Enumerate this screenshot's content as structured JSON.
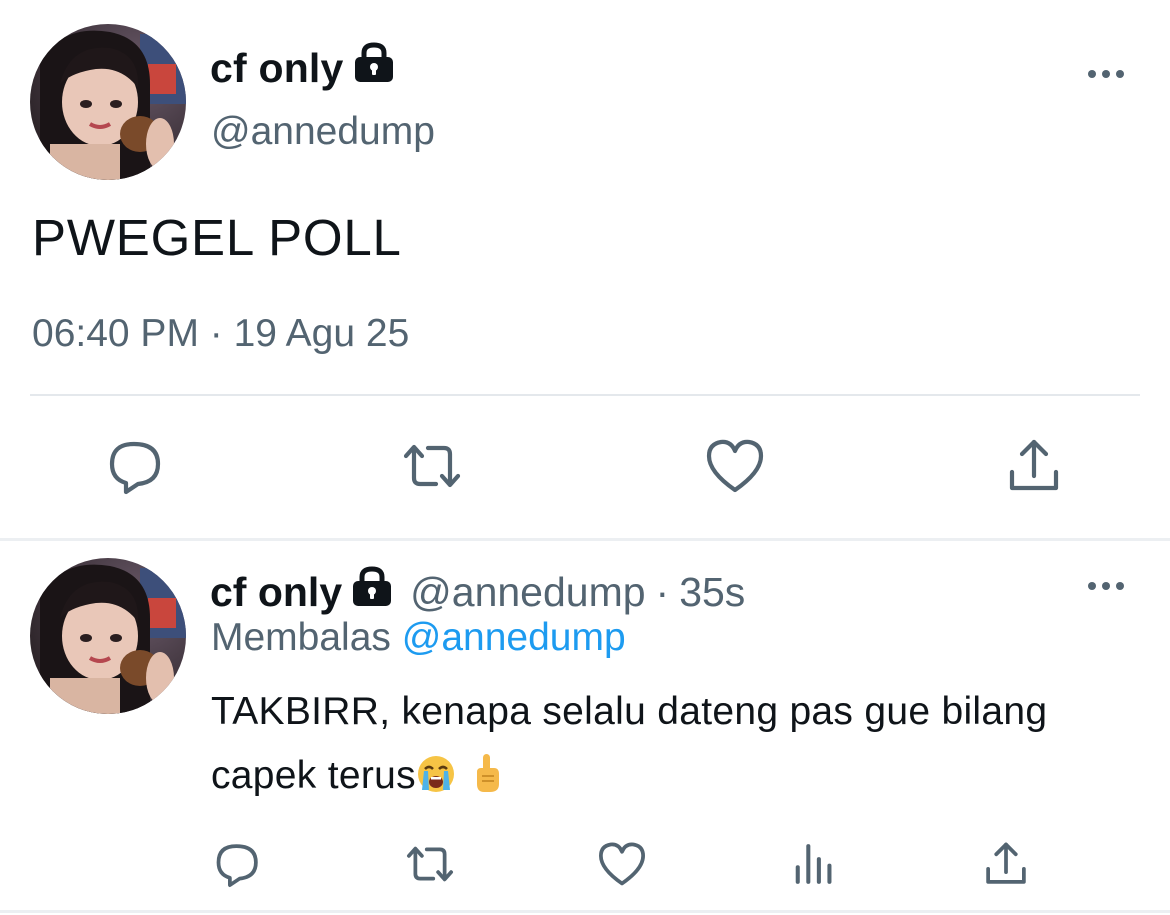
{
  "tweet": {
    "display_name": "cf only",
    "handle": "@annedump",
    "text": "PWEGEL POLL",
    "timestamp": "06:40 PM · 19 Agu 25",
    "actions": [
      "reply",
      "retweet",
      "like",
      "share"
    ]
  },
  "reply": {
    "display_name": "cf only",
    "handle": "@annedump",
    "separator": "·",
    "time_ago": "35s",
    "replying_prefix": "Membalas",
    "replying_to": "@annedump",
    "text": "TAKBIRR, kenapa selalu dateng pas gue bilang capek terus",
    "emojis": [
      "loudly-crying-face",
      "pointing-up"
    ],
    "actions": [
      "reply",
      "retweet",
      "like",
      "views",
      "share"
    ]
  },
  "icons": {
    "lock": "lock-icon",
    "more": "more-icon",
    "reply": "reply-icon",
    "retweet": "retweet-icon",
    "like": "heart-icon",
    "views": "views-icon",
    "share": "share-icon"
  },
  "colors": {
    "text": "#0f1419",
    "secondary": "#536471",
    "link": "#1d9bf0",
    "divider": "#e4e8ec"
  }
}
